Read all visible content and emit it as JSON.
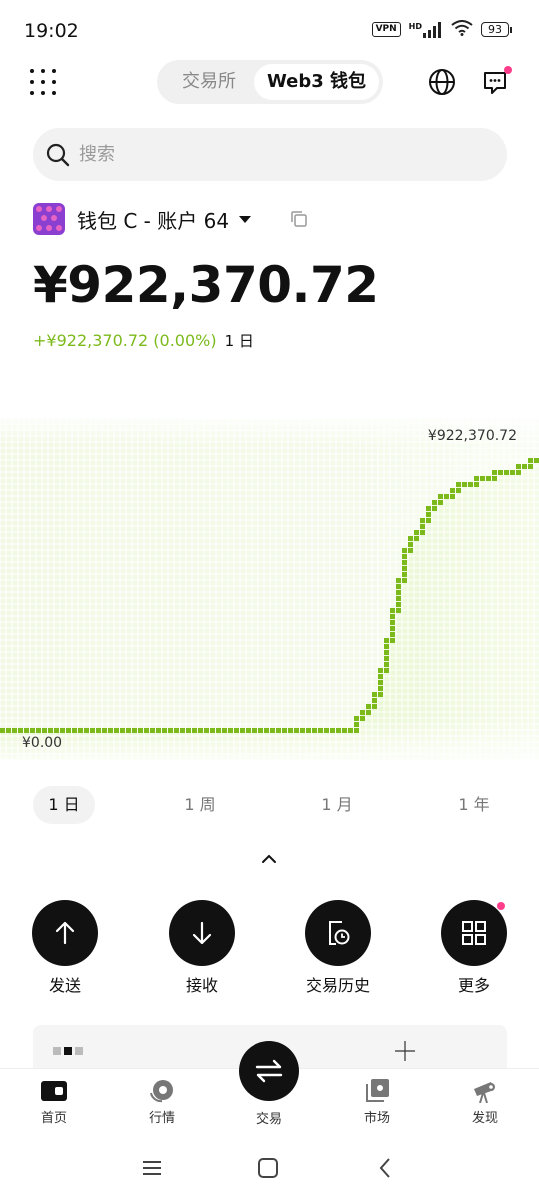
{
  "status": {
    "time": "19:02",
    "vpn": "VPN",
    "network": "HD",
    "battery": "93"
  },
  "top": {
    "tab_exchange": "交易所",
    "tab_web3": "Web3 钱包",
    "icons": [
      "apps-grid-icon",
      "globe-icon",
      "message-icon"
    ]
  },
  "search": {
    "placeholder": "搜索"
  },
  "wallet": {
    "name": "钱包 C - 账户 64",
    "balance": "¥922,370.72",
    "change": "+¥922,370.72 (0.00%)",
    "change_period": "1 日"
  },
  "chart_data": {
    "type": "line",
    "x": [
      0,
      1,
      2,
      3,
      4,
      5,
      6,
      7,
      8,
      9,
      10,
      11,
      12,
      13,
      14,
      15,
      16,
      17,
      18,
      19,
      20
    ],
    "series": [
      {
        "values": [
          0,
          0,
          0,
          0,
          0,
          0,
          0,
          0,
          0,
          0,
          0,
          0,
          0,
          0,
          130000,
          610000,
          760000,
          830000,
          860000,
          880000,
          922370.72
        ]
      }
    ],
    "ylim": [
      0,
      922370.72
    ],
    "max_label": "¥922,370.72",
    "min_label": "¥0.00",
    "grid": true,
    "color": "#7cba1c"
  },
  "ranges": [
    "1 日",
    "1 周",
    "1 月",
    "1 年"
  ],
  "actions": {
    "send": "发送",
    "receive": "接收",
    "history": "交易历史",
    "more": "更多"
  },
  "tabs": {
    "home": "首页",
    "market": "行情",
    "trade": "交易",
    "marketplace": "市场",
    "discover": "发现"
  },
  "colors": {
    "accent_green": "#7cba1c",
    "badge_pink": "#ff3d8b",
    "primary": "#111111"
  }
}
